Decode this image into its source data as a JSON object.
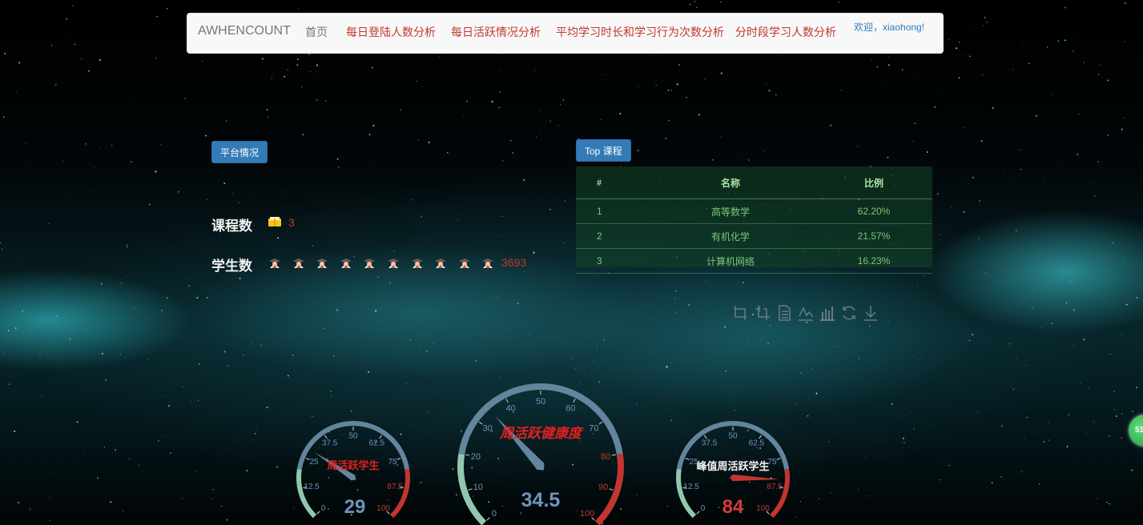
{
  "navbar": {
    "brand": "AWHENCOUNT",
    "items": [
      {
        "label": "首页"
      },
      {
        "label": "每日登陆人数分析"
      },
      {
        "label": "每日活跃情况分析"
      },
      {
        "label": "平均学习时长和学习行为次数分析"
      },
      {
        "label": "分时段学习人数分析"
      }
    ],
    "welcome": "欢迎，xiaohong!"
  },
  "platform": {
    "button_label": "平台情况",
    "course_count_label": "课程数",
    "course_count": "3",
    "student_count_label": "学生数",
    "student_count": "3693"
  },
  "top_courses": {
    "button_label": "Top 课程",
    "headers": [
      "#",
      "名称",
      "比例"
    ],
    "rows": [
      {
        "idx": "1",
        "name": "高等数学",
        "ratio": "62.20%"
      },
      {
        "idx": "2",
        "name": "有机化学",
        "ratio": "21.57%"
      },
      {
        "idx": "3",
        "name": "计算机网络",
        "ratio": "16.23%"
      }
    ]
  },
  "toolbox": [
    "zoom-icon",
    "zoom-reset-icon",
    "data-view-icon",
    "line-chart-icon",
    "bar-chart-icon",
    "restore-icon",
    "save-image-icon"
  ],
  "gauges": {
    "left": {
      "title": "周活跃学生",
      "value": "29",
      "ticks": [
        "0",
        "12.5",
        "25",
        "37.5",
        "50",
        "62.5",
        "75",
        "87.5",
        "100"
      ]
    },
    "center": {
      "title": "周活跃健康度",
      "value": "34.5",
      "ticks": [
        "0",
        "10",
        "20",
        "30",
        "40",
        "50",
        "60",
        "70",
        "80",
        "90",
        "100"
      ]
    },
    "right": {
      "title": "峰值周活跃学生",
      "value": "84",
      "ticks": [
        "0",
        "12.5",
        "25",
        "37.5",
        "50",
        "62.5",
        "75",
        "87.5",
        "100"
      ]
    }
  },
  "side_badge": "51",
  "colors": {
    "accent": "#337ab7",
    "danger": "#c0392b",
    "table_text": "#7fc77a"
  }
}
